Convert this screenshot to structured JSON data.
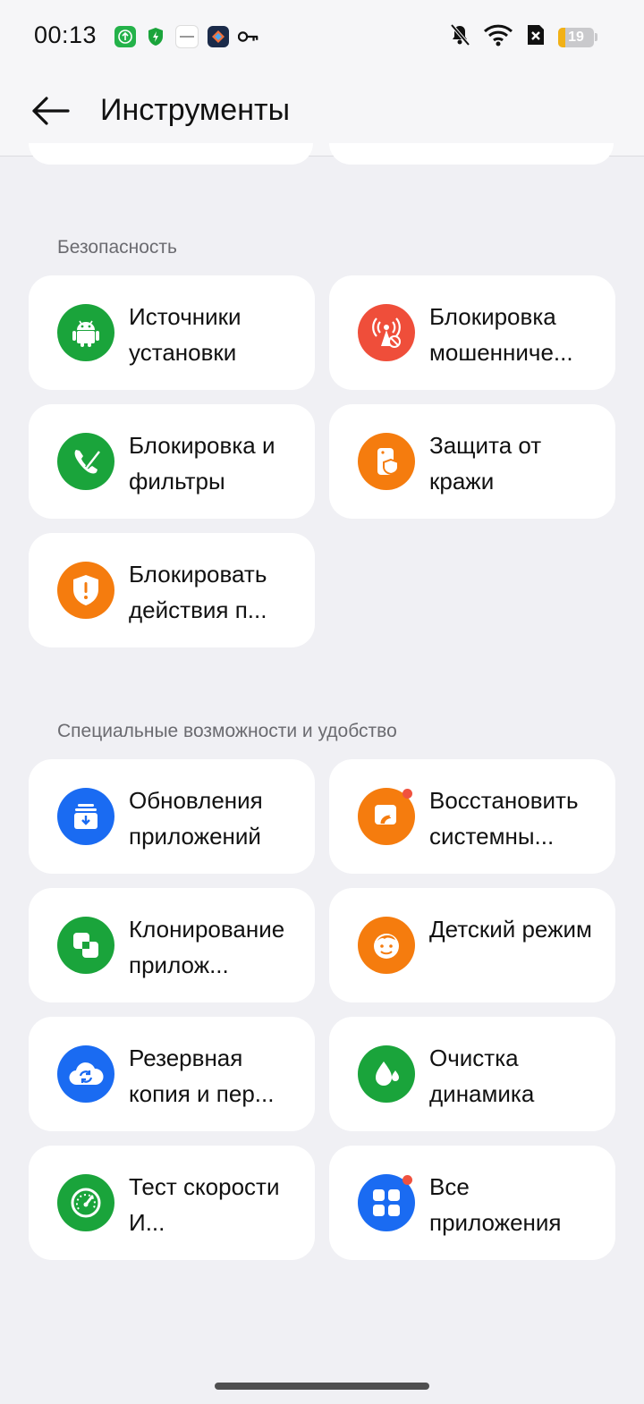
{
  "status_bar": {
    "time": "00:13",
    "battery_level": "19",
    "battery_percent": 19,
    "left_icons": [
      "upload-app-icon",
      "shield-app-icon",
      "media-app-icon",
      "photos-app-icon",
      "key-icon"
    ],
    "right_icons": [
      "bell-off-icon",
      "wifi-icon",
      "no-sim-icon",
      "battery-icon"
    ]
  },
  "header": {
    "title": "Инструменты"
  },
  "sections": [
    {
      "label": "Безопасность",
      "items": [
        {
          "label": "Источники установки",
          "icon": "android-icon",
          "color": "#1aa43b"
        },
        {
          "label": "Блокировка мошенниче...",
          "icon": "fraud-block-icon",
          "color": "#ef4e3a"
        },
        {
          "label": "Блокировка и фильтры",
          "icon": "call-block-icon",
          "color": "#1aa43b"
        },
        {
          "label": "Защита от кражи",
          "icon": "theft-protection-icon",
          "color": "#f57c0e"
        },
        {
          "label": "Блокировать действия п...",
          "icon": "shield-alert-icon",
          "color": "#f57c0e"
        }
      ]
    },
    {
      "label": "Специальные возможности и удобство",
      "items": [
        {
          "label": "Обновления приложений",
          "icon": "app-update-icon",
          "color": "#1a6bf2"
        },
        {
          "label": "Восстановить системны...",
          "icon": "restore-icon",
          "color": "#f57c0e",
          "badge": true
        },
        {
          "label": "Клонирование прилож...",
          "icon": "clone-icon",
          "color": "#1aa43b"
        },
        {
          "label": "Детский режим",
          "icon": "kid-face-icon",
          "color": "#f57c0e"
        },
        {
          "label": "Резервная копия и пер...",
          "icon": "cloud-sync-icon",
          "color": "#1a6bf2"
        },
        {
          "label": "Очистка динамика",
          "icon": "water-drops-icon",
          "color": "#1aa43b"
        },
        {
          "label": "Тест скорости И...",
          "icon": "speedometer-icon",
          "color": "#1aa43b"
        },
        {
          "label": "Все приложения",
          "icon": "grid-apps-icon",
          "color": "#1a6bf2",
          "badge": true
        }
      ]
    }
  ]
}
